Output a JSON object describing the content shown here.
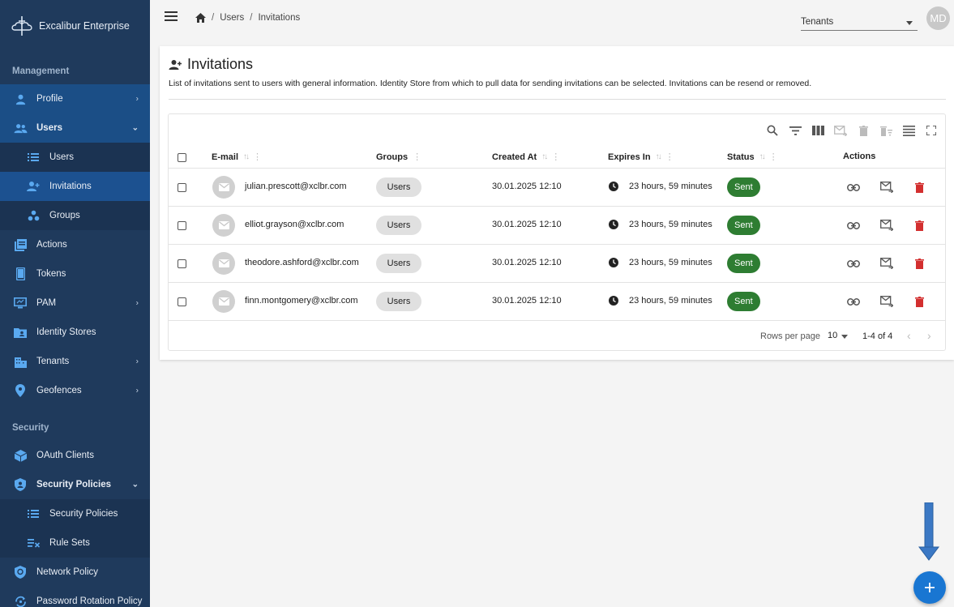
{
  "app": {
    "name": "Excalibur Enterprise"
  },
  "sidebar": {
    "sections": {
      "management": "Management",
      "security": "Security"
    },
    "items": {
      "profile": "Profile",
      "users": "Users",
      "users_list": "Users",
      "invitations": "Invitations",
      "groups": "Groups",
      "actions": "Actions",
      "tokens": "Tokens",
      "pam": "PAM",
      "identity_stores": "Identity Stores",
      "tenants": "Tenants",
      "geofences": "Geofences",
      "oauth_clients": "OAuth Clients",
      "security_policies": "Security Policies",
      "security_policies_list": "Security Policies",
      "rule_sets": "Rule Sets",
      "network_policy": "Network Policy",
      "password_rotation_policy": "Password Rotation Policy"
    }
  },
  "header": {
    "breadcrumb": [
      "Users",
      "Invitations"
    ],
    "tenant_select": "Tenants",
    "avatar_initials": "MD"
  },
  "page": {
    "title": "Invitations",
    "description": "List of invitations sent to users with general information. Identity Store from which to pull data for sending invitations can be selected. Invitations can be resend or removed."
  },
  "table": {
    "columns": {
      "email": "E-mail",
      "groups": "Groups",
      "created_at": "Created At",
      "expires_in": "Expires In",
      "status": "Status",
      "actions": "Actions"
    },
    "rows": [
      {
        "email": "julian.prescott@xclbr.com",
        "group": "Users",
        "created": "30.01.2025 12:10",
        "expires": "23 hours, 59 minutes",
        "status": "Sent"
      },
      {
        "email": "elliot.grayson@xclbr.com",
        "group": "Users",
        "created": "30.01.2025 12:10",
        "expires": "23 hours, 59 minutes",
        "status": "Sent"
      },
      {
        "email": "theodore.ashford@xclbr.com",
        "group": "Users",
        "created": "30.01.2025 12:10",
        "expires": "23 hours, 59 minutes",
        "status": "Sent"
      },
      {
        "email": "finn.montgomery@xclbr.com",
        "group": "Users",
        "created": "30.01.2025 12:10",
        "expires": "23 hours, 59 minutes",
        "status": "Sent"
      }
    ],
    "footer": {
      "rows_per_page_label": "Rows per page",
      "rows_per_page_value": "10",
      "range": "1-4 of 4"
    }
  },
  "colors": {
    "sidebar_bg": "#1f3a5c",
    "active_bg": "#1c5190",
    "status_sent": "#2e7d32",
    "delete": "#d32f2f",
    "fab": "#1976d2"
  },
  "icons": [
    "home-icon",
    "menu-icon",
    "search-icon",
    "filter-icon",
    "columns-icon",
    "resend-icon",
    "delete-icon",
    "density-icon",
    "fullscreen-icon",
    "link-icon",
    "clock-icon",
    "mail-icon",
    "add-icon"
  ]
}
